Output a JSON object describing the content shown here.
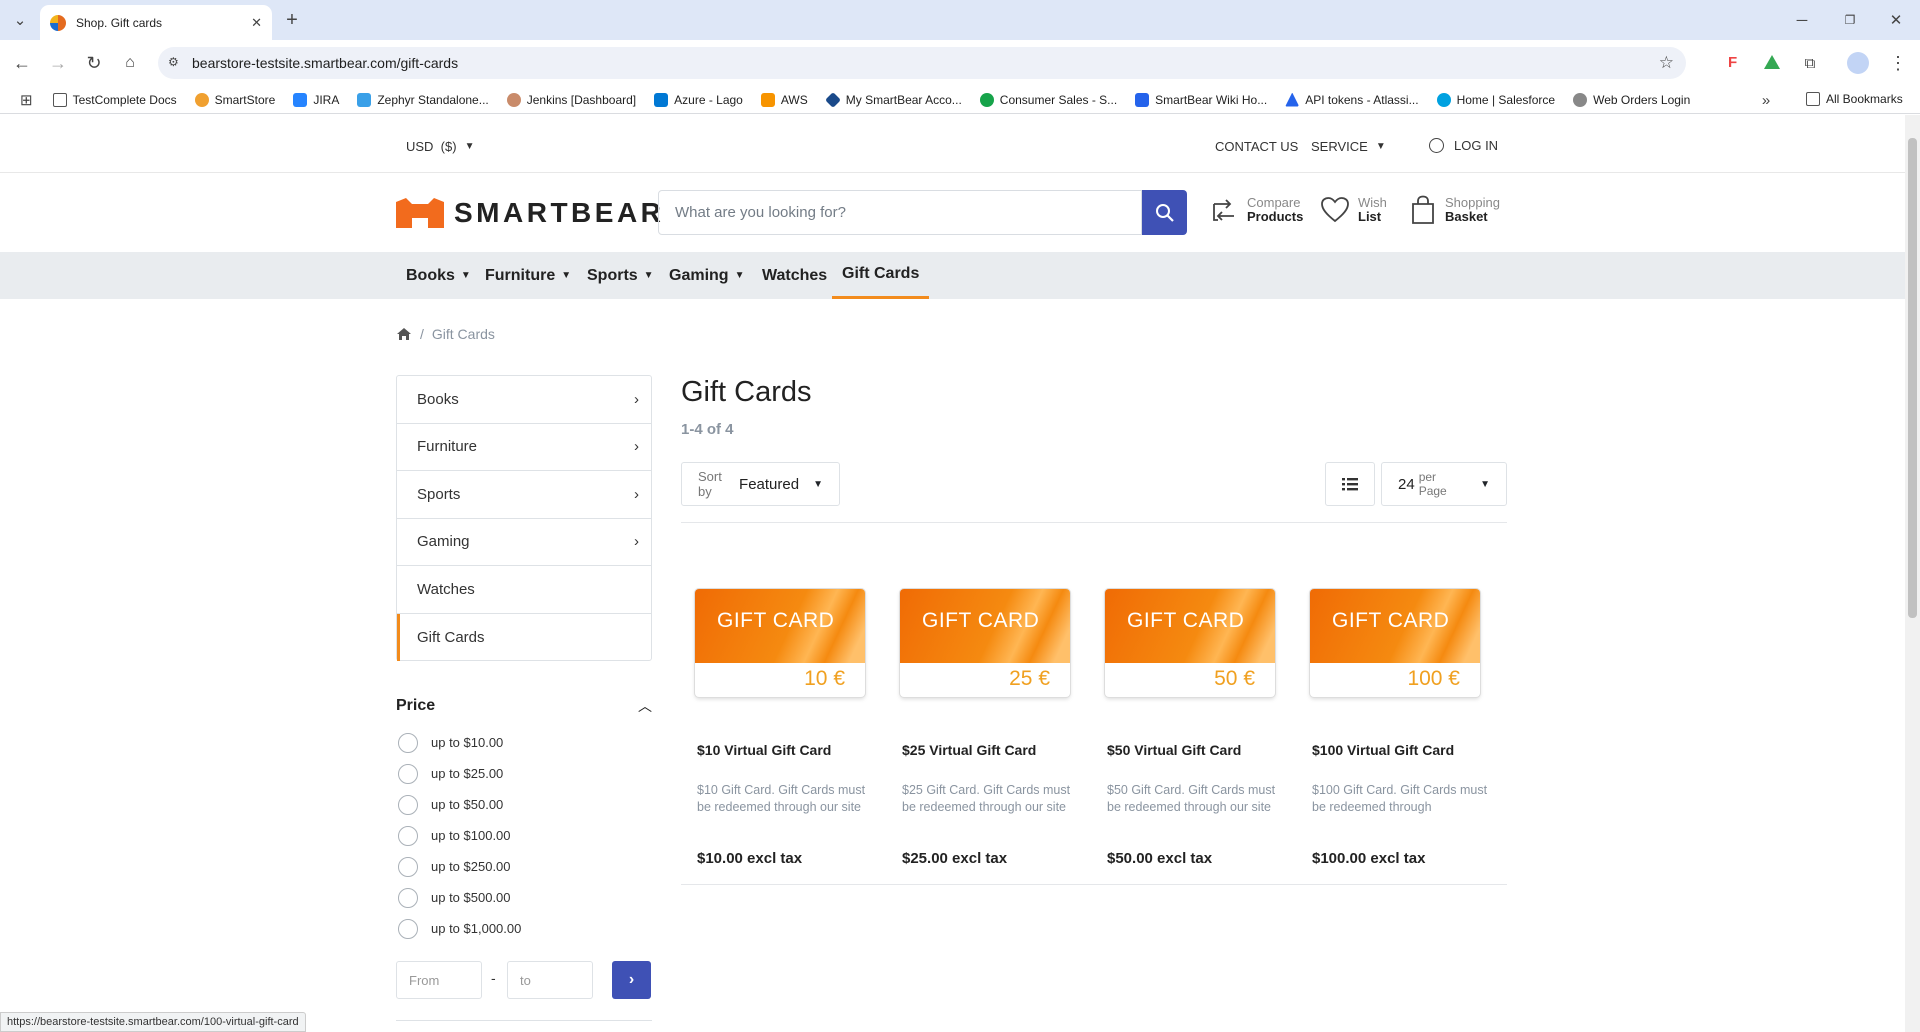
{
  "browser": {
    "tab_title": "Shop. Gift cards",
    "url": "bearstore-testsite.smartbear.com/gift-cards",
    "bookmarks": [
      "TestComplete Docs",
      "SmartStore",
      "JIRA",
      "Zephyr Standalone...",
      "Jenkins [Dashboard]",
      "Azure - Lago",
      "AWS",
      "My SmartBear Acco...",
      "Consumer Sales - S...",
      "SmartBear Wiki Ho...",
      "API tokens - Atlassi...",
      "Home | Salesforce",
      "Web Orders Login"
    ],
    "all_bookmarks": "All Bookmarks",
    "status_url": "https://bearstore-testsite.smartbear.com/100-virtual-gift-card"
  },
  "topbar": {
    "currency": "USD  ($)",
    "contact": "CONTACT US",
    "service": "SERVICE",
    "login": "LOG IN"
  },
  "header": {
    "logo_text": "SMARTBEAR",
    "search_placeholder": "What are you looking for?",
    "compare_top": "Compare",
    "compare_bottom": "Products",
    "wish_top": "Wish",
    "wish_bottom": "List",
    "basket_top": "Shopping",
    "basket_bottom": "Basket"
  },
  "nav": [
    "Books",
    "Furniture",
    "Sports",
    "Gaming",
    "Watches",
    "Gift Cards"
  ],
  "breadcrumb": {
    "current": "Gift Cards"
  },
  "sidebar": {
    "categories": [
      "Books",
      "Furniture",
      "Sports",
      "Gaming",
      "Watches",
      "Gift Cards"
    ],
    "price_title": "Price",
    "price_options": [
      "up to $10.00",
      "up to $25.00",
      "up to $50.00",
      "up to $100.00",
      "up to $250.00",
      "up to $500.00",
      "up to $1,000.00"
    ],
    "from_placeholder": "From",
    "to_placeholder": "to",
    "range_sep": "-"
  },
  "main": {
    "title": "Gift Cards",
    "count": "1-4 of 4",
    "sort_prefix": "Sort by",
    "sort_value": "Featured",
    "per_page_num": "24",
    "per_page_label": "per Page",
    "products": [
      {
        "card_label": "GIFT CARD",
        "amount": "10 €",
        "title": "$10 Virtual Gift Card",
        "desc": "$10 Gift Card. Gift Cards must be redeemed through our site",
        "price": "$10.00 excl tax"
      },
      {
        "card_label": "GIFT CARD",
        "amount": "25 €",
        "title": "$25 Virtual Gift Card",
        "desc": "$25 Gift Card. Gift Cards must be redeemed through our site",
        "price": "$25.00 excl tax"
      },
      {
        "card_label": "GIFT CARD",
        "amount": "50 €",
        "title": "$50 Virtual Gift Card",
        "desc": "$50 Gift Card. Gift Cards must be redeemed through our site",
        "price": "$50.00 excl tax"
      },
      {
        "card_label": "GIFT CARD",
        "amount": "100 €",
        "title": "$100 Virtual Gift Card",
        "desc": "$100 Gift Card. Gift Cards must be redeemed through",
        "price": "$100.00 excl tax"
      }
    ]
  },
  "colors": {
    "accent": "#3f51b5",
    "orange": "#f28b1c",
    "nav_bg": "#e9ecef"
  }
}
